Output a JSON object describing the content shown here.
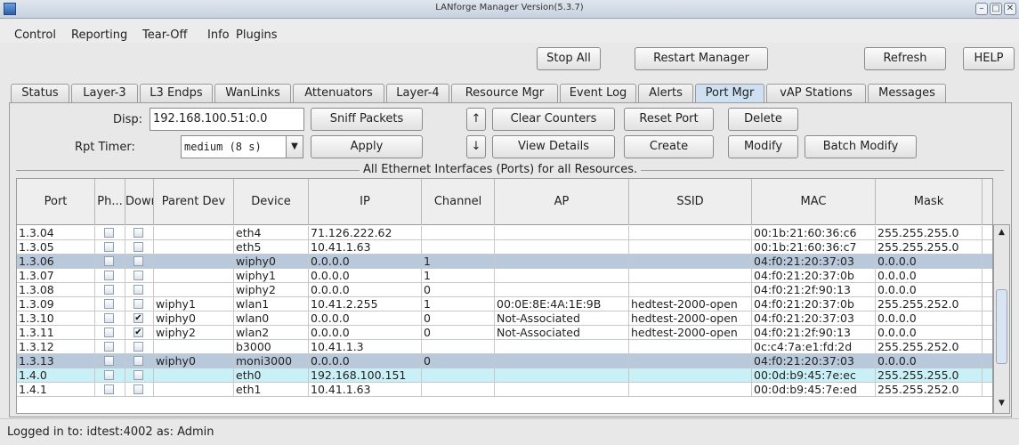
{
  "window": {
    "title": "LANforge Manager  Version(5.3.7)",
    "controls": [
      "–",
      "□",
      "✕"
    ]
  },
  "menu": [
    "Control",
    "Reporting",
    "Tear-Off",
    "Info",
    "Plugins"
  ],
  "toolbar": {
    "stop_all": "Stop All",
    "restart_manager": "Restart Manager",
    "refresh": "Refresh",
    "help": "HELP"
  },
  "tabs": [
    {
      "label": "Status",
      "active": false
    },
    {
      "label": "Layer-3",
      "active": false
    },
    {
      "label": "L3 Endps",
      "active": false
    },
    {
      "label": "WanLinks",
      "active": false
    },
    {
      "label": "Attenuators",
      "active": false
    },
    {
      "label": "Layer-4",
      "active": false
    },
    {
      "label": "Resource Mgr",
      "active": false
    },
    {
      "label": "Event Log",
      "active": false
    },
    {
      "label": "Alerts",
      "active": false
    },
    {
      "label": "Port Mgr",
      "active": true
    },
    {
      "label": "vAP Stations",
      "active": false
    },
    {
      "label": "Messages",
      "active": false
    }
  ],
  "controls": {
    "disp_label": "Disp:",
    "disp_value": "192.168.100.51:0.0",
    "rpt_timer_label": "Rpt Timer:",
    "rpt_timer_value": "medium  (8 s)",
    "sniff_packets": "Sniff Packets",
    "apply": "Apply",
    "up_arrow": "↑",
    "down_arrow": "↓",
    "clear_counters": "Clear Counters",
    "view_details": "View Details",
    "reset_port": "Reset Port",
    "create": "Create",
    "delete": "Delete",
    "modify": "Modify",
    "batch_modify": "Batch Modify"
  },
  "group_title": "All Ethernet Interfaces (Ports) for all Resources.",
  "table": {
    "columns": [
      "Port",
      "Ph...",
      "Down",
      "Parent Dev",
      "Device",
      "IP",
      "Channel",
      "AP",
      "SSID",
      "MAC",
      "Mask"
    ],
    "rows": [
      {
        "port": "1.3.04",
        "down": false,
        "parent": "",
        "device": "eth4",
        "ip": "71.126.222.62",
        "channel": "",
        "ap": "",
        "ssid": "",
        "mac": "00:1b:21:60:36:c6",
        "mask": "255.255.255.0",
        "style": "normal"
      },
      {
        "port": "1.3.05",
        "down": false,
        "parent": "",
        "device": "eth5",
        "ip": "10.41.1.63",
        "channel": "",
        "ap": "",
        "ssid": "",
        "mac": "00:1b:21:60:36:c7",
        "mask": "255.255.255.0",
        "style": "normal"
      },
      {
        "port": "1.3.06",
        "down": false,
        "parent": "",
        "device": "wiphy0",
        "ip": "0.0.0.0",
        "channel": "1",
        "ap": "",
        "ssid": "",
        "mac": "04:f0:21:20:37:03",
        "mask": "0.0.0.0",
        "style": "selected"
      },
      {
        "port": "1.3.07",
        "down": false,
        "parent": "",
        "device": "wiphy1",
        "ip": "0.0.0.0",
        "channel": "1",
        "ap": "",
        "ssid": "",
        "mac": "04:f0:21:20:37:0b",
        "mask": "0.0.0.0",
        "style": "normal"
      },
      {
        "port": "1.3.08",
        "down": false,
        "parent": "",
        "device": "wiphy2",
        "ip": "0.0.0.0",
        "channel": "0",
        "ap": "",
        "ssid": "",
        "mac": "04:f0:21:2f:90:13",
        "mask": "0.0.0.0",
        "style": "normal"
      },
      {
        "port": "1.3.09",
        "down": false,
        "parent": "wiphy1",
        "device": "wlan1",
        "ip": "10.41.2.255",
        "channel": "1",
        "ap": "00:0E:8E:4A:1E:9B",
        "ssid": "hedtest-2000-open",
        "mac": "04:f0:21:20:37:0b",
        "mask": "255.255.252.0",
        "style": "normal"
      },
      {
        "port": "1.3.10",
        "down": true,
        "parent": "wiphy0",
        "device": "wlan0",
        "ip": "0.0.0.0",
        "channel": "0",
        "ap": "Not-Associated",
        "ssid": "hedtest-2000-open",
        "mac": "04:f0:21:20:37:03",
        "mask": "0.0.0.0",
        "style": "normal"
      },
      {
        "port": "1.3.11",
        "down": true,
        "parent": "wiphy2",
        "device": "wlan2",
        "ip": "0.0.0.0",
        "channel": "0",
        "ap": "Not-Associated",
        "ssid": "hedtest-2000-open",
        "mac": "04:f0:21:2f:90:13",
        "mask": "0.0.0.0",
        "style": "normal"
      },
      {
        "port": "1.3.12",
        "down": false,
        "parent": "",
        "device": "b3000",
        "ip": "10.41.1.3",
        "channel": "",
        "ap": "",
        "ssid": "",
        "mac": "0c:c4:7a:e1:fd:2d",
        "mask": "255.255.252.0",
        "style": "normal"
      },
      {
        "port": "1.3.13",
        "down": false,
        "parent": "wiphy0",
        "device": "moni3000",
        "ip": "0.0.0.0",
        "channel": "0",
        "ap": "",
        "ssid": "",
        "mac": "04:f0:21:20:37:03",
        "mask": "0.0.0.0",
        "style": "selected"
      },
      {
        "port": "1.4.0",
        "down": false,
        "parent": "",
        "device": "eth0",
        "ip": "192.168.100.151",
        "channel": "",
        "ap": "",
        "ssid": "",
        "mac": "00:0d:b9:45:7e:ec",
        "mask": "255.255.255.0",
        "style": "hover"
      },
      {
        "port": "1.4.1",
        "down": false,
        "parent": "",
        "device": "eth1",
        "ip": "10.41.1.63",
        "channel": "",
        "ap": "",
        "ssid": "",
        "mac": "00:0d:b9:45:7e:ed",
        "mask": "255.255.252.0",
        "style": "normal"
      }
    ]
  },
  "status": {
    "text": "Logged in to:  idtest:4002  as:  Admin"
  },
  "colors": {
    "selected_row": "#b9c9dc",
    "hover_row": "#c9f0f7",
    "active_tab": "#cfe0f3"
  }
}
